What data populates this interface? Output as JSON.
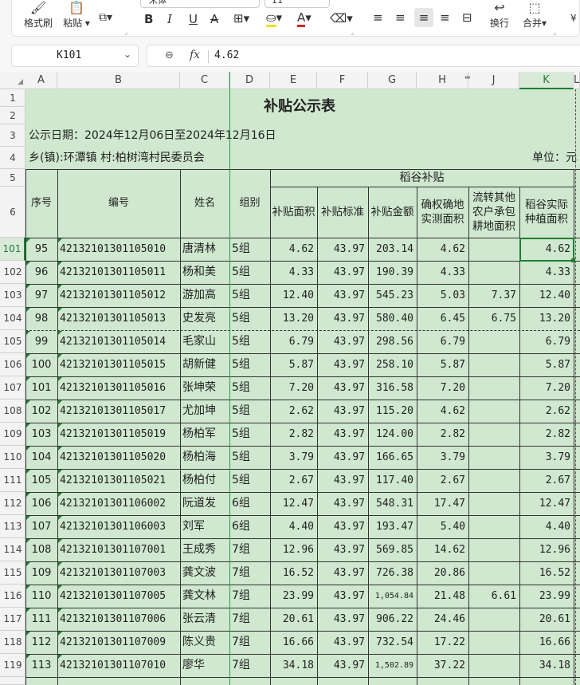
{
  "toolbar": {
    "format_painter": "格式刷",
    "paste": "粘贴",
    "font_name": "宋体",
    "font_size": "11",
    "wrap": "换行",
    "merge": "合并"
  },
  "formula_bar": {
    "name_box": "K101",
    "fx": "fx",
    "value": "4.62"
  },
  "columns": [
    "A",
    "B",
    "C",
    "D",
    "E",
    "F",
    "G",
    "H",
    "J",
    "K",
    "L"
  ],
  "sheet": {
    "title": "补贴公示表",
    "date_line": "公示日期：2024年12月06日至2024年12月16日",
    "location": "乡(镇):环潭镇 村:柏树湾村民委员会",
    "unit": "单位：元",
    "group_header": "稻谷补贴",
    "headers": {
      "seq": "序号",
      "code": "编号",
      "name": "姓名",
      "group": "组别",
      "area": "补贴面积",
      "std": "补贴标准",
      "amount": "补贴金额",
      "confirmed": "确权确地实测面积",
      "transfer": "流转其他农户承包耕地面积",
      "actual": "稻谷实际种植面积"
    },
    "header_row_nums": [
      "1",
      "2",
      "3",
      "4",
      "5",
      "6"
    ],
    "rows": [
      {
        "r": "101",
        "seq": "95",
        "code": "42132101301105010",
        "name": "唐清林",
        "group": "5组",
        "area": "4.62",
        "std": "43.97",
        "amount": "203.14",
        "confirmed": "4.62",
        "transfer": "",
        "actual": "4.62"
      },
      {
        "r": "102",
        "seq": "96",
        "code": "42132101301105011",
        "name": "杨和美",
        "group": "5组",
        "area": "4.33",
        "std": "43.97",
        "amount": "190.39",
        "confirmed": "4.33",
        "transfer": "",
        "actual": "4.33"
      },
      {
        "r": "103",
        "seq": "97",
        "code": "42132101301105012",
        "name": "游加高",
        "group": "5组",
        "area": "12.40",
        "std": "43.97",
        "amount": "545.23",
        "confirmed": "5.03",
        "transfer": "7.37",
        "actual": "12.40"
      },
      {
        "r": "104",
        "seq": "98",
        "code": "42132101301105013",
        "name": "史发亮",
        "group": "5组",
        "area": "13.20",
        "std": "43.97",
        "amount": "580.40",
        "confirmed": "6.45",
        "transfer": "6.75",
        "actual": "13.20"
      },
      {
        "r": "105",
        "seq": "99",
        "code": "42132101301105014",
        "name": "毛家山",
        "group": "5组",
        "area": "6.79",
        "std": "43.97",
        "amount": "298.56",
        "confirmed": "6.79",
        "transfer": "",
        "actual": "6.79"
      },
      {
        "r": "106",
        "seq": "100",
        "code": "42132101301105015",
        "name": "胡新健",
        "group": "5组",
        "area": "5.87",
        "std": "43.97",
        "amount": "258.10",
        "confirmed": "5.87",
        "transfer": "",
        "actual": "5.87"
      },
      {
        "r": "107",
        "seq": "101",
        "code": "42132101301105016",
        "name": "张坤荣",
        "group": "5组",
        "area": "7.20",
        "std": "43.97",
        "amount": "316.58",
        "confirmed": "7.20",
        "transfer": "",
        "actual": "7.20"
      },
      {
        "r": "108",
        "seq": "102",
        "code": "42132101301105017",
        "name": "尤加坤",
        "group": "5组",
        "area": "2.62",
        "std": "43.97",
        "amount": "115.20",
        "confirmed": "4.62",
        "transfer": "",
        "actual": "2.62"
      },
      {
        "r": "109",
        "seq": "103",
        "code": "42132101301105019",
        "name": "杨柏军",
        "group": "5组",
        "area": "2.82",
        "std": "43.97",
        "amount": "124.00",
        "confirmed": "2.82",
        "transfer": "",
        "actual": "2.82"
      },
      {
        "r": "110",
        "seq": "104",
        "code": "42132101301105020",
        "name": "杨柏海",
        "group": "5组",
        "area": "3.79",
        "std": "43.97",
        "amount": "166.65",
        "confirmed": "3.79",
        "transfer": "",
        "actual": "3.79"
      },
      {
        "r": "111",
        "seq": "105",
        "code": "42132101301105021",
        "name": "杨柏付",
        "group": "5组",
        "area": "2.67",
        "std": "43.97",
        "amount": "117.40",
        "confirmed": "2.67",
        "transfer": "",
        "actual": "2.67"
      },
      {
        "r": "112",
        "seq": "106",
        "code": "42132101301106002",
        "name": "阮道发",
        "group": "6组",
        "area": "12.47",
        "std": "43.97",
        "amount": "548.31",
        "confirmed": "17.47",
        "transfer": "",
        "actual": "12.47"
      },
      {
        "r": "113",
        "seq": "107",
        "code": "42132101301106003",
        "name": "刘军",
        "group": "6组",
        "area": "4.40",
        "std": "43.97",
        "amount": "193.47",
        "confirmed": "5.40",
        "transfer": "",
        "actual": "4.40"
      },
      {
        "r": "114",
        "seq": "108",
        "code": "42132101301107001",
        "name": "王成秀",
        "group": "7组",
        "area": "12.96",
        "std": "43.97",
        "amount": "569.85",
        "confirmed": "14.62",
        "transfer": "",
        "actual": "12.96"
      },
      {
        "r": "115",
        "seq": "109",
        "code": "42132101301107003",
        "name": "龚文波",
        "group": "7组",
        "area": "16.52",
        "std": "43.97",
        "amount": "726.38",
        "confirmed": "20.86",
        "transfer": "",
        "actual": "16.52"
      },
      {
        "r": "116",
        "seq": "110",
        "code": "42132101301107005",
        "name": "龚文林",
        "group": "7组",
        "area": "23.99",
        "std": "43.97",
        "amount": "1,054.84",
        "confirmed": "21.48",
        "transfer": "6.61",
        "actual": "23.99"
      },
      {
        "r": "117",
        "seq": "111",
        "code": "42132101301107006",
        "name": "张云清",
        "group": "7组",
        "area": "20.61",
        "std": "43.97",
        "amount": "906.22",
        "confirmed": "24.46",
        "transfer": "",
        "actual": "20.61"
      },
      {
        "r": "118",
        "seq": "112",
        "code": "42132101301107009",
        "name": "陈义贵",
        "group": "7组",
        "area": "16.66",
        "std": "43.97",
        "amount": "732.54",
        "confirmed": "17.22",
        "transfer": "",
        "actual": "16.66"
      },
      {
        "r": "119",
        "seq": "113",
        "code": "42132101301107010",
        "name": "廖华",
        "group": "7组",
        "area": "34.18",
        "std": "43.97",
        "amount": "1,502.89",
        "confirmed": "37.22",
        "transfer": "",
        "actual": "34.18"
      }
    ]
  },
  "colors": {
    "cell_green": "#cfe8cf",
    "selected_border": "#1e7e34",
    "header_bg": "#f3f3f3"
  }
}
